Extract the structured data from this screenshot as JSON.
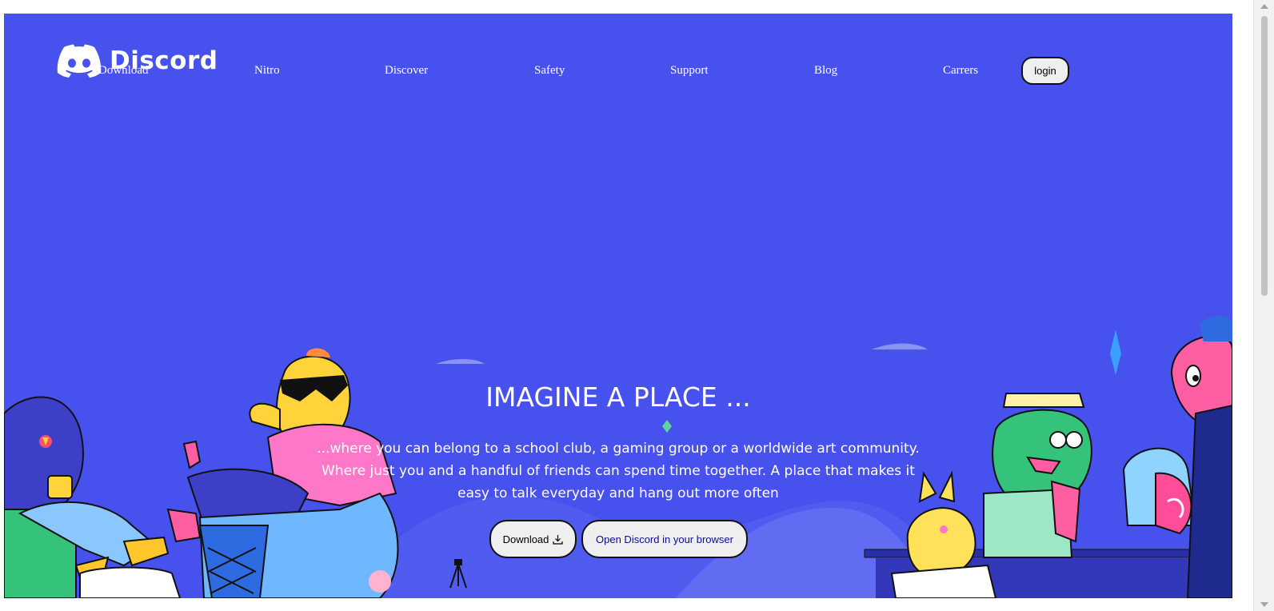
{
  "brand": {
    "name": "Discord",
    "background_color": "#4752ee"
  },
  "nav": {
    "items": [
      {
        "label": "Download"
      },
      {
        "label": "Nitro"
      },
      {
        "label": "Discover"
      },
      {
        "label": "Safety"
      },
      {
        "label": "Support"
      },
      {
        "label": "Blog"
      },
      {
        "label": "Carrers"
      }
    ],
    "login_label": "login"
  },
  "hero": {
    "title": "IMAGINE A PLACE ...",
    "text": "...where you can belong to a school club, a gaming group or a worldwide art community. Where just you and a handful of friends can spend time together. A place that makes it easy to talk everyday and hang out more often",
    "download_label": "Download",
    "browser_label": "Open Discord in your browser"
  }
}
